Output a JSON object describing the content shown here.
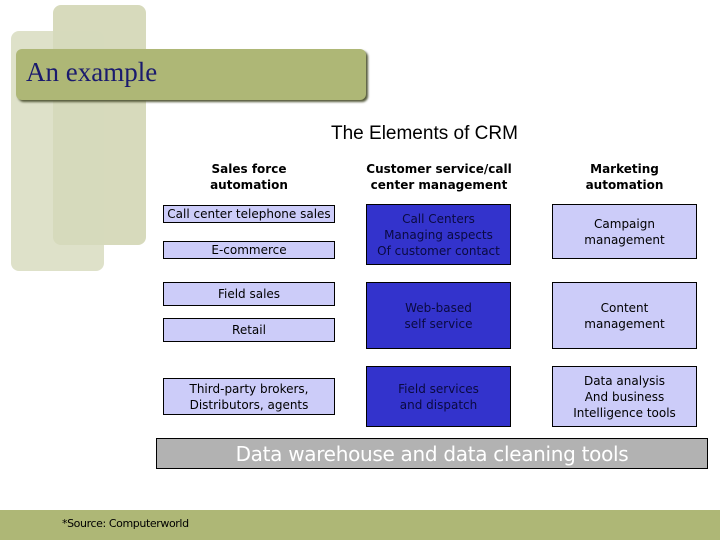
{
  "slide": {
    "heading": "An example",
    "title": "The Elements of CRM",
    "colors": {
      "banner": "#aeb776",
      "light_box": "#ccccf9",
      "dark_box": "#3333cc",
      "data_bar": "#b2b2b2"
    }
  },
  "columns": [
    {
      "header": "Sales force\nautomation",
      "items": [
        "Call center telephone sales",
        "E-commerce",
        "Field sales",
        "Retail",
        "Third-party brokers,\nDistributors, agents"
      ]
    },
    {
      "header": "Customer service/call\ncenter management",
      "items": [
        "Call Centers\nManaging aspects\nOf customer contact",
        "Web-based\nself service",
        "Field services\nand dispatch"
      ]
    },
    {
      "header": "Marketing\nautomation",
      "items": [
        "Campaign\nmanagement",
        "Content\nmanagement",
        "Data analysis\nAnd business\nIntelligence tools"
      ]
    }
  ],
  "foundation": "Data warehouse and data cleaning tools",
  "footer": {
    "source": "*Source: Computerworld"
  }
}
